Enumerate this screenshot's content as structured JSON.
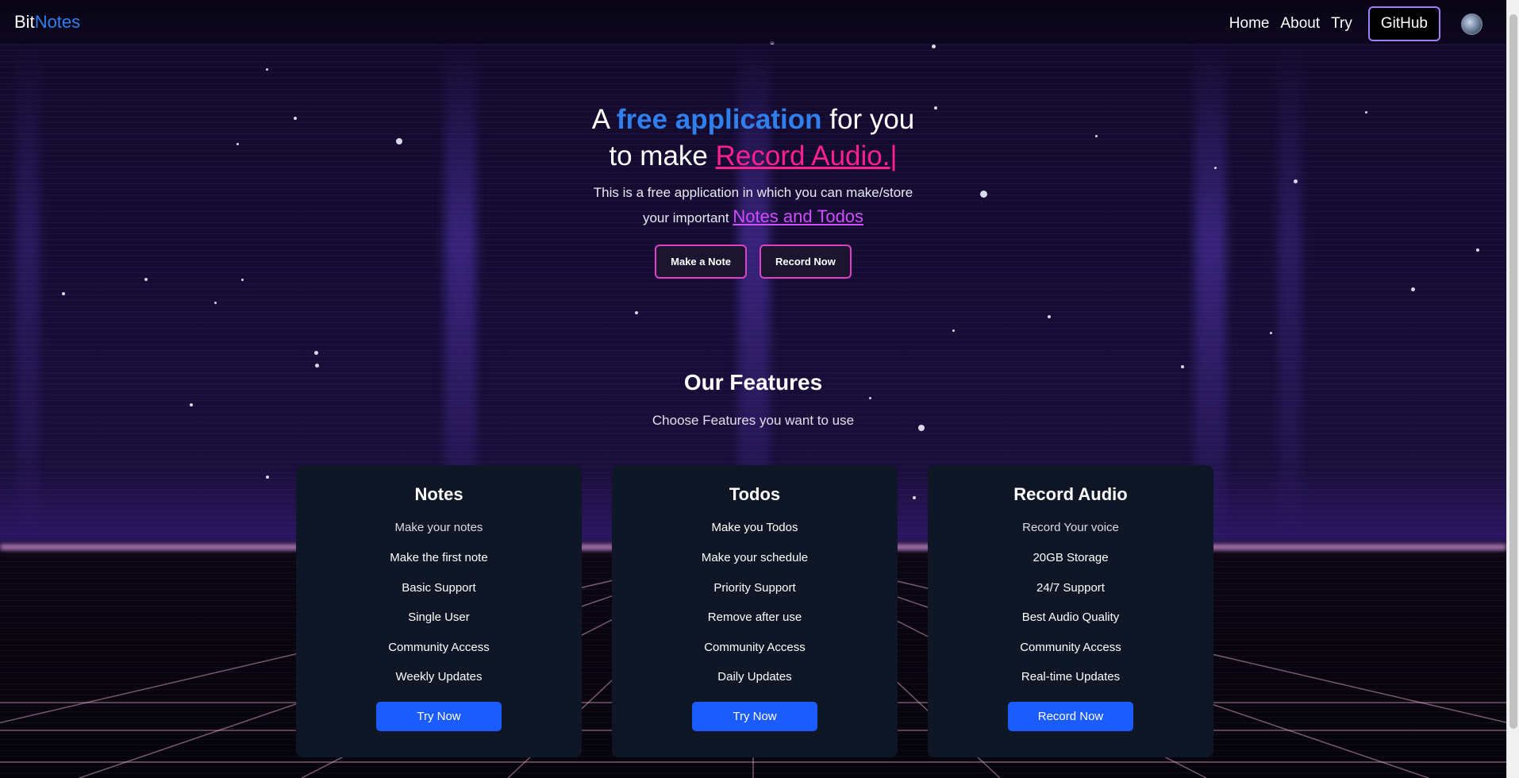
{
  "nav": {
    "brand_part1": "Bit",
    "brand_part2": "Notes",
    "links": [
      "Home",
      "About",
      "Try"
    ],
    "github_label": "GitHub"
  },
  "hero": {
    "line1_pre": "A ",
    "line1_highlight": "free application",
    "line1_post": " for you",
    "line2_pre": "to make ",
    "line2_highlight": "Record Audio.",
    "line2_cursor": "|",
    "desc_line1": "This is a free application in which you can make/store",
    "desc_line2_pre": "your important ",
    "desc_line2_highlight": "Notes and Todos",
    "button1": "Make a Note",
    "button2": "Record Now"
  },
  "features": {
    "title": "Our Features",
    "subtitle": "Choose Features you want to use",
    "cards": [
      {
        "title": "Notes",
        "subtitle": "Make your notes",
        "items": [
          "Make the first note",
          "Basic Support",
          "Single User",
          "Community Access",
          "Weekly Updates"
        ],
        "button": "Try Now"
      },
      {
        "title": "Todos",
        "subtitle": "Make you Todos",
        "items": [
          "Make your schedule",
          "Priority Support",
          "Remove after use",
          "Community Access",
          "Daily Updates"
        ],
        "button": "Try Now"
      },
      {
        "title": "Record Audio",
        "subtitle": "Record Your voice",
        "items": [
          "20GB Storage",
          "24/7 Support",
          "Best Audio Quality",
          "Community Access",
          "Real-time Updates"
        ],
        "button": "Record Now"
      }
    ]
  },
  "colors": {
    "brand_blue": "#2f80ed",
    "accent_pink": "#ff1f8f",
    "accent_purple": "#d14cff",
    "button_blue": "#1a5cff",
    "card_bg": "#0f1626"
  },
  "icons": {
    "avatar": "user-avatar-icon"
  }
}
